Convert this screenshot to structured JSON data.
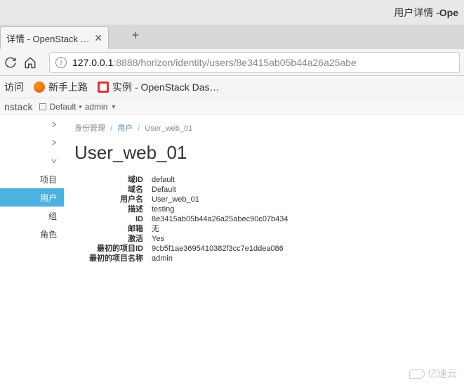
{
  "window": {
    "title_prefix": "用户详情 - ",
    "title_app": "Ope"
  },
  "tab": {
    "label": "详情 - OpenStack Da…"
  },
  "url": {
    "host": "127.0.0.1",
    "path": ":8888/horizon/identity/users/8e3415ab05b44a26a25abe"
  },
  "bookmarks": {
    "frequent": "访问",
    "getting_started": "新手上路",
    "instances": "实例 - OpenStack Das…"
  },
  "header": {
    "brand": "nstack",
    "domain": "Default",
    "user": "admin"
  },
  "sidebar": {
    "items": [
      "项目",
      "用户",
      "组",
      "角色"
    ],
    "active_index": 1
  },
  "breadcrumb": {
    "root": "身份管理",
    "mid": "用户",
    "current": "User_web_01"
  },
  "page_title": "User_web_01",
  "details": [
    {
      "label": "域ID",
      "value": "default"
    },
    {
      "label": "域名",
      "value": "Default"
    },
    {
      "label": "用户名",
      "value": "User_web_01"
    },
    {
      "label": "描述",
      "value": "testing"
    },
    {
      "label": "ID",
      "value": "8e3415ab05b44a26a25abec90c07b434"
    },
    {
      "label": "邮箱",
      "value": "无"
    },
    {
      "label": "激活",
      "value": "Yes"
    },
    {
      "label": "最初的项目ID",
      "value": "9cb5f1ae3695410382f3cc7e1ddea086"
    },
    {
      "label": "最初的项目名称",
      "value": "admin"
    }
  ],
  "watermark": "亿速云"
}
